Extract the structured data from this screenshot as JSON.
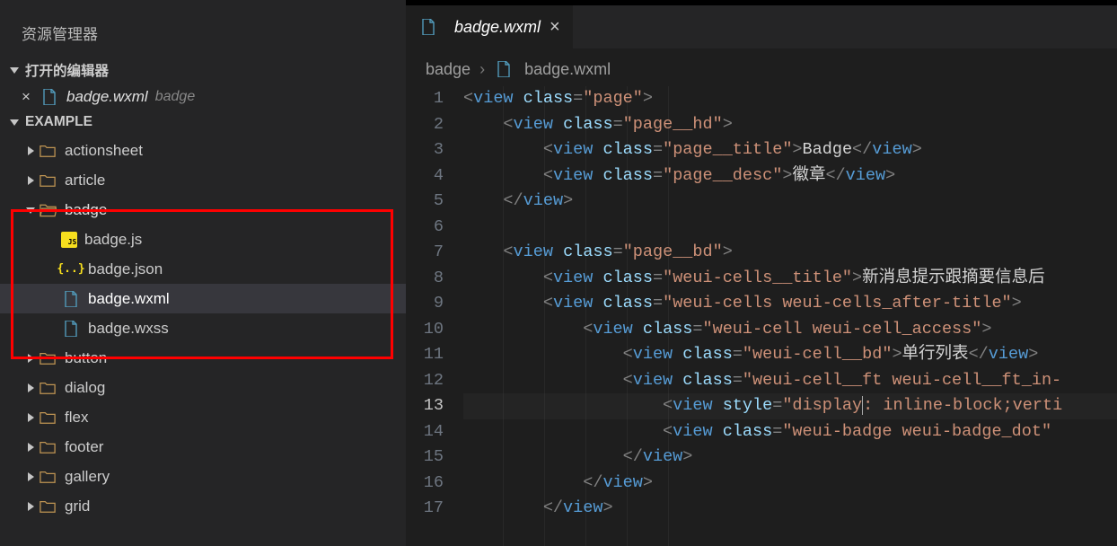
{
  "explorer": {
    "title": "资源管理器",
    "sections": {
      "open_editors": {
        "label": "打开的编辑器",
        "items": [
          {
            "filename": "badge.wxml",
            "dir": "badge",
            "icon": "file"
          }
        ]
      },
      "project": {
        "label": "EXAMPLE",
        "tree": [
          {
            "type": "folder",
            "name": "actionsheet",
            "depth": 1,
            "expanded": false
          },
          {
            "type": "folder",
            "name": "article",
            "depth": 1,
            "expanded": false
          },
          {
            "type": "folder",
            "name": "badge",
            "depth": 1,
            "expanded": true
          },
          {
            "type": "file-js",
            "name": "badge.js",
            "depth": 2
          },
          {
            "type": "file-json",
            "name": "badge.json",
            "depth": 2
          },
          {
            "type": "file",
            "name": "badge.wxml",
            "depth": 2,
            "selected": true
          },
          {
            "type": "file",
            "name": "badge.wxss",
            "depth": 2
          },
          {
            "type": "folder",
            "name": "button",
            "depth": 1,
            "expanded": false
          },
          {
            "type": "folder",
            "name": "dialog",
            "depth": 1,
            "expanded": false
          },
          {
            "type": "folder",
            "name": "flex",
            "depth": 1,
            "expanded": false
          },
          {
            "type": "folder",
            "name": "footer",
            "depth": 1,
            "expanded": false
          },
          {
            "type": "folder",
            "name": "gallery",
            "depth": 1,
            "expanded": false
          },
          {
            "type": "folder",
            "name": "grid",
            "depth": 1,
            "expanded": false
          }
        ]
      }
    }
  },
  "editor": {
    "tab": {
      "filename": "badge.wxml"
    },
    "breadcrumbs": {
      "folder": "badge",
      "file": "badge.wxml"
    },
    "current_line": 13,
    "lines": [
      {
        "n": 1,
        "indent": 0,
        "html": "<span class='brk'>&lt;</span><span class='tag'>view</span> <span class='attr'>class</span><span class='brk'>=</span><span class='str'>\"page\"</span><span class='brk'>&gt;</span>"
      },
      {
        "n": 2,
        "indent": 1,
        "html": "<span class='brk'>&lt;</span><span class='tag'>view</span> <span class='attr'>class</span><span class='brk'>=</span><span class='str'>\"page__hd\"</span><span class='brk'>&gt;</span>"
      },
      {
        "n": 3,
        "indent": 2,
        "html": "<span class='brk'>&lt;</span><span class='tag'>view</span> <span class='attr'>class</span><span class='brk'>=</span><span class='str'>\"page__title\"</span><span class='brk'>&gt;</span><span class='txt'>Badge</span><span class='brk'>&lt;/</span><span class='tag'>view</span><span class='brk'>&gt;</span>"
      },
      {
        "n": 4,
        "indent": 2,
        "html": "<span class='brk'>&lt;</span><span class='tag'>view</span> <span class='attr'>class</span><span class='brk'>=</span><span class='str'>\"page__desc\"</span><span class='brk'>&gt;</span><span class='txt'>徽章</span><span class='brk'>&lt;/</span><span class='tag'>view</span><span class='brk'>&gt;</span>"
      },
      {
        "n": 5,
        "indent": 1,
        "html": "<span class='brk'>&lt;/</span><span class='tag'>view</span><span class='brk'>&gt;</span>"
      },
      {
        "n": 6,
        "indent": 0,
        "html": ""
      },
      {
        "n": 7,
        "indent": 1,
        "html": "<span class='brk'>&lt;</span><span class='tag'>view</span> <span class='attr'>class</span><span class='brk'>=</span><span class='str'>\"page__bd\"</span><span class='brk'>&gt;</span>"
      },
      {
        "n": 8,
        "indent": 2,
        "html": "<span class='brk'>&lt;</span><span class='tag'>view</span> <span class='attr'>class</span><span class='brk'>=</span><span class='str'>\"weui-cells__title\"</span><span class='brk'>&gt;</span><span class='txt'>新消息提示跟摘要信息后</span>"
      },
      {
        "n": 9,
        "indent": 2,
        "html": "<span class='brk'>&lt;</span><span class='tag'>view</span> <span class='attr'>class</span><span class='brk'>=</span><span class='str'>\"weui-cells weui-cells_after-title\"</span><span class='brk'>&gt;</span>"
      },
      {
        "n": 10,
        "indent": 3,
        "html": "<span class='brk'>&lt;</span><span class='tag'>view</span> <span class='attr'>class</span><span class='brk'>=</span><span class='str'>\"weui-cell weui-cell_access\"</span><span class='brk'>&gt;</span>"
      },
      {
        "n": 11,
        "indent": 4,
        "html": "<span class='brk'>&lt;</span><span class='tag'>view</span> <span class='attr'>class</span><span class='brk'>=</span><span class='str'>\"weui-cell__bd\"</span><span class='brk'>&gt;</span><span class='txt'>单行列表</span><span class='brk'>&lt;/</span><span class='tag'>view</span><span class='brk'>&gt;</span>"
      },
      {
        "n": 12,
        "indent": 4,
        "html": "<span class='brk'>&lt;</span><span class='tag'>view</span> <span class='attr'>class</span><span class='brk'>=</span><span class='str'>\"weui-cell__ft weui-cell__ft_in-</span>"
      },
      {
        "n": 13,
        "indent": 5,
        "html": "<span class='brk'>&lt;</span><span class='tag'>view</span> <span class='attr'>style</span><span class='brk'>=</span><span class='str'>\"display<span style='border-left:1px solid #aaa;'></span>: inline-block;verti</span>"
      },
      {
        "n": 14,
        "indent": 5,
        "html": "<span class='brk'>&lt;</span><span class='tag'>view</span> <span class='attr'>class</span><span class='brk'>=</span><span class='str'>\"weui-badge weui-badge_dot\"</span> "
      },
      {
        "n": 15,
        "indent": 4,
        "html": "<span class='brk'>&lt;/</span><span class='tag'>view</span><span class='brk'>&gt;</span>"
      },
      {
        "n": 16,
        "indent": 3,
        "html": "<span class='brk'>&lt;/</span><span class='tag'>view</span><span class='brk'>&gt;</span>"
      },
      {
        "n": 17,
        "indent": 2,
        "html": "<span class='brk'>&lt;/</span><span class='tag'>view</span><span class='brk'>&gt;</span>"
      }
    ]
  },
  "icons": {
    "chevron_right": "▶",
    "chevron_down": "▼",
    "close": "×",
    "json_label": "{..}"
  }
}
